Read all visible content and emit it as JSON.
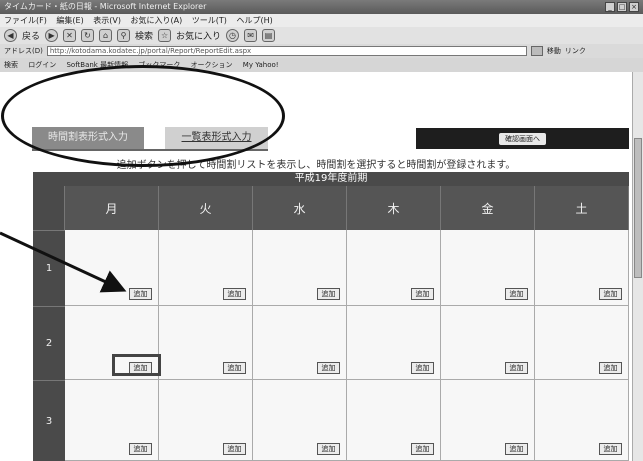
{
  "window": {
    "title": "タイムカード・紙の日報 - Microsoft Internet Explorer",
    "controls": [
      "_",
      "□",
      "×"
    ]
  },
  "menu": [
    "ファイル(F)",
    "編集(E)",
    "表示(V)",
    "お気に入り(A)",
    "ツール(T)",
    "ヘルプ(H)"
  ],
  "toolbar": {
    "back_label": "戻る",
    "search_label": "検索",
    "favorites_label": "お気に入り"
  },
  "address": {
    "label": "アドレス(D)",
    "url": "http://kotodama.kodatec.jp/portal/Report/ReportEdit.aspx",
    "go_label": "移動",
    "links_label": "リンク"
  },
  "linkbar": [
    "検索",
    "ログイン",
    "SoftBank 最新情報",
    "ブックマーク",
    "オークション",
    "My Yahoo!"
  ],
  "tabs": {
    "timetable_input": "時間割表形式入力",
    "list_input": "一覧表形式入力"
  },
  "confirm_button": "確認画面へ",
  "instruction": "追加ボタンを押して時間割リストを表示し、時間割を選択すると時間割が登録されます。",
  "term_header": "平成19年度前期",
  "days": [
    "月",
    "火",
    "水",
    "木",
    "金",
    "土"
  ],
  "periods": [
    "1",
    "2",
    "3"
  ],
  "add_label": "追加"
}
